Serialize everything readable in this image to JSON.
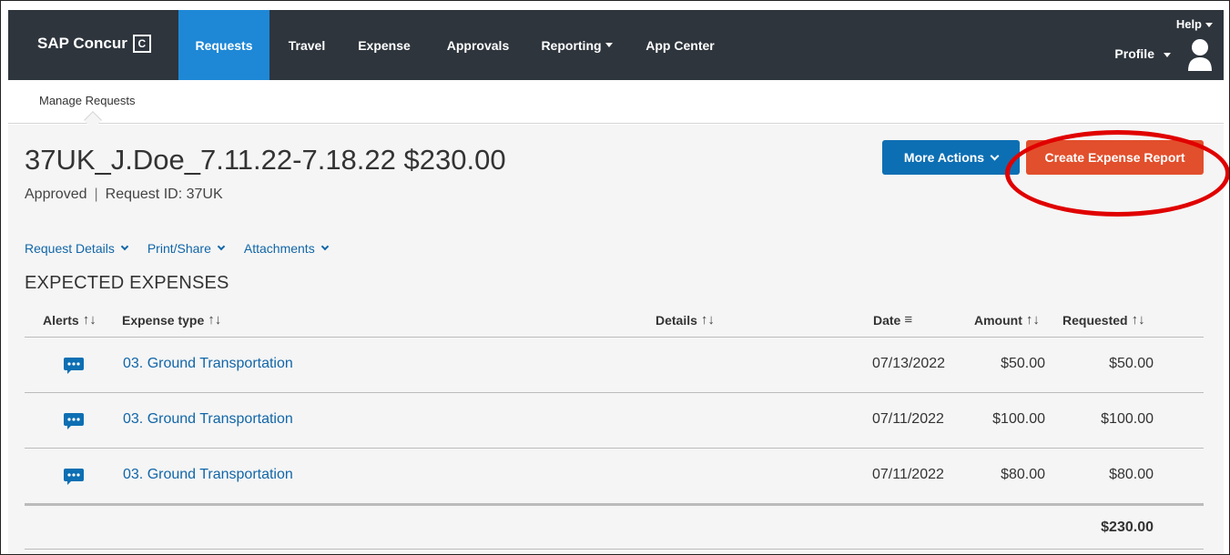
{
  "nav": {
    "brand": "SAP Concur",
    "brand_logo": "C",
    "items": [
      {
        "label": "Requests",
        "active": true
      },
      {
        "label": "Travel"
      },
      {
        "label": "Expense"
      },
      {
        "label": "Approvals"
      },
      {
        "label": "Reporting"
      },
      {
        "label": "App Center"
      }
    ],
    "help": "Help",
    "profile": "Profile"
  },
  "subnav": {
    "manage_requests": "Manage Requests"
  },
  "request": {
    "title": "37UK_J.Doe_7.11.22-7.18.22 $230.00",
    "status": "Approved",
    "separator": "|",
    "request_id": "Request ID: 37UK"
  },
  "actions": {
    "more_actions": "More Actions",
    "create_expense_report": "Create Expense Report"
  },
  "links": {
    "request_details": "Request Details",
    "print_share": "Print/Share",
    "attachments": "Attachments"
  },
  "section_title": "EXPECTED EXPENSES",
  "table": {
    "headers": {
      "alerts": "Alerts",
      "expense_type": "Expense type",
      "details": "Details",
      "date": "Date",
      "amount": "Amount",
      "requested": "Requested"
    },
    "sort_glyph": "↑↓",
    "filter_glyph": "≡",
    "rows": [
      {
        "expense_type": "03. Ground Transportation",
        "details": "",
        "date": "07/13/2022",
        "amount": "$50.00",
        "requested": "$50.00"
      },
      {
        "expense_type": "03. Ground Transportation",
        "details": "",
        "date": "07/11/2022",
        "amount": "$100.00",
        "requested": "$100.00"
      },
      {
        "expense_type": "03. Ground Transportation",
        "details": "",
        "date": "07/11/2022",
        "amount": "$80.00",
        "requested": "$80.00"
      }
    ],
    "total": "$230.00"
  },
  "colors": {
    "nav_bg": "#2e353d",
    "nav_active": "#1e88d6",
    "primary_button": "#0d6fb3",
    "create_button": "#e24f2c",
    "link": "#1166a8",
    "highlight_ring": "#e00000"
  },
  "icons": {
    "brand": "concur-c-logo-icon",
    "avatar": "user-avatar-icon",
    "alert": "chat-bubble-icon",
    "dropdown": "chevron-down-icon",
    "sort": "sort-arrows-icon",
    "filter": "filter-lines-icon"
  }
}
